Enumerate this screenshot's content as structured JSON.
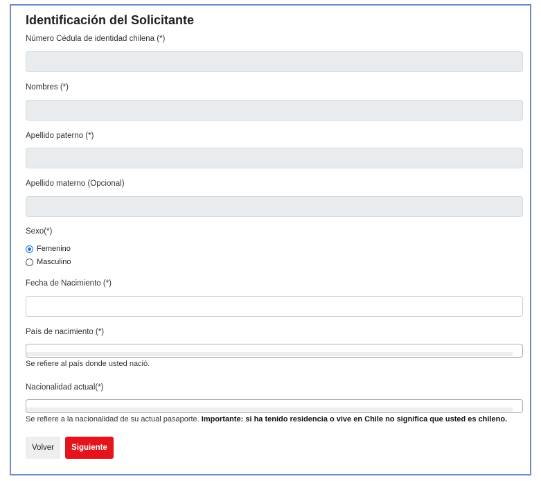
{
  "form": {
    "title": "Identificación del Solicitante",
    "fields": {
      "cedula": {
        "label": "Número Cédula de identidad chilena (*)",
        "value": ""
      },
      "nombres": {
        "label": "Nombres (*)",
        "value": ""
      },
      "apellido_paterno": {
        "label": "Apellido paterno (*)",
        "value": ""
      },
      "apellido_materno": {
        "label": "Apellido materno (Opcional)",
        "value": ""
      },
      "sexo": {
        "label": "Sexo(*)",
        "options": [
          {
            "label": "Femenino",
            "checked": true
          },
          {
            "label": "Masculino",
            "checked": false
          }
        ]
      },
      "fecha_nacimiento": {
        "label": "Fecha de Nacimiento (*)",
        "value": ""
      },
      "pais_nacimiento": {
        "label": "País de nacimiento (*)",
        "help": "Se refiere al país donde usted nació."
      },
      "nacionalidad": {
        "label": "Nacionalidad actual(*)",
        "help": "Se refiere a la nacionalidad de su actual pasaporte. ",
        "help_bold": "Importante: si ha tenido residencia o vive en Chile no significa que usted es chileno."
      }
    },
    "buttons": {
      "back": "Volver",
      "next": "Siguiente"
    }
  },
  "colors": {
    "border": "#6b8cc4",
    "primary": "#e3141b",
    "radio": "#1a73e8"
  }
}
